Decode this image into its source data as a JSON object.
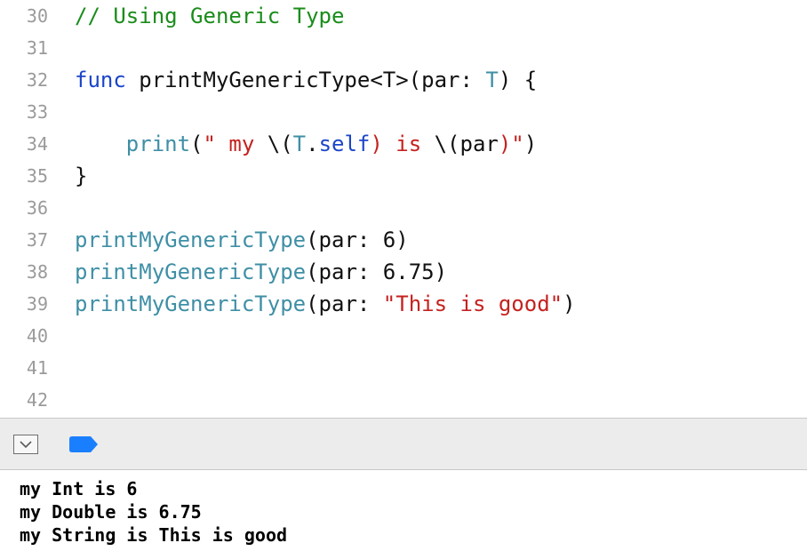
{
  "editor": {
    "lines": [
      {
        "num": "30",
        "tokens": [
          {
            "t": "comment",
            "v": "// Using Generic Type"
          }
        ]
      },
      {
        "num": "31",
        "tokens": []
      },
      {
        "num": "32",
        "tokens": [
          {
            "t": "keyword",
            "v": "func"
          },
          {
            "t": "plain",
            "v": " printMyGenericType<T>(par: "
          },
          {
            "t": "type",
            "v": "T"
          },
          {
            "t": "plain",
            "v": ") {"
          }
        ]
      },
      {
        "num": "33",
        "tokens": []
      },
      {
        "num": "34",
        "tokens": [
          {
            "t": "plain",
            "v": "    "
          },
          {
            "t": "fn",
            "v": "print"
          },
          {
            "t": "plain",
            "v": "("
          },
          {
            "t": "string",
            "v": "\" my "
          },
          {
            "t": "interp",
            "v": "\\("
          },
          {
            "t": "type",
            "v": "T"
          },
          {
            "t": "plain",
            "v": "."
          },
          {
            "t": "keyword",
            "v": "self"
          },
          {
            "t": "string",
            "v": ") is "
          },
          {
            "t": "interp",
            "v": "\\(par"
          },
          {
            "t": "string",
            "v": ")\""
          },
          {
            "t": "plain",
            "v": ")"
          }
        ]
      },
      {
        "num": "35",
        "tokens": [
          {
            "t": "plain",
            "v": "}"
          }
        ]
      },
      {
        "num": "36",
        "tokens": []
      },
      {
        "num": "37",
        "tokens": [
          {
            "t": "fn",
            "v": "printMyGenericType"
          },
          {
            "t": "plain",
            "v": "(par: "
          },
          {
            "t": "number",
            "v": "6"
          },
          {
            "t": "plain",
            "v": ")"
          }
        ]
      },
      {
        "num": "38",
        "tokens": [
          {
            "t": "fn",
            "v": "printMyGenericType"
          },
          {
            "t": "plain",
            "v": "(par: "
          },
          {
            "t": "number",
            "v": "6.75"
          },
          {
            "t": "plain",
            "v": ")"
          }
        ]
      },
      {
        "num": "39",
        "tokens": [
          {
            "t": "fn",
            "v": "printMyGenericType"
          },
          {
            "t": "plain",
            "v": "(par: "
          },
          {
            "t": "string",
            "v": "\"This is good\""
          },
          {
            "t": "plain",
            "v": ")"
          }
        ]
      },
      {
        "num": "40",
        "tokens": []
      },
      {
        "num": "41",
        "tokens": []
      },
      {
        "num": "42",
        "tokens": []
      }
    ]
  },
  "debug_bar": {
    "toggle_icon": "chevron-down-in-box-icon",
    "breakpoint_icon": "breakpoint-tag-icon",
    "breakpoint_color": "#1a7fff"
  },
  "console": {
    "output": [
      "my Int is 6",
      "my Double is 6.75",
      "my String is This is good"
    ]
  },
  "colors": {
    "comment": "#1a8c1a",
    "keyword": "#1b45c9",
    "function": "#3f8fa6",
    "string": "#c4221f",
    "line_number": "#9a9a9a"
  }
}
